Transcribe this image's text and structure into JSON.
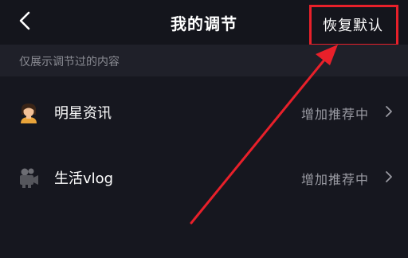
{
  "header": {
    "title": "我的调节",
    "back_icon": "chevron-left-icon",
    "reset_label": "恢复默认"
  },
  "hint": "仅展示调节过的内容",
  "rows": [
    {
      "label": "明星资讯",
      "status": "增加推荐中",
      "icon": "star-person-icon"
    },
    {
      "label": "生活vlog",
      "status": "增加推荐中",
      "icon": "camera-icon"
    }
  ],
  "colors": {
    "background": "#16171f",
    "hint_bar": "#1f2029",
    "annotation_red": "#e8202a",
    "status_text": "#9a9ba3"
  }
}
